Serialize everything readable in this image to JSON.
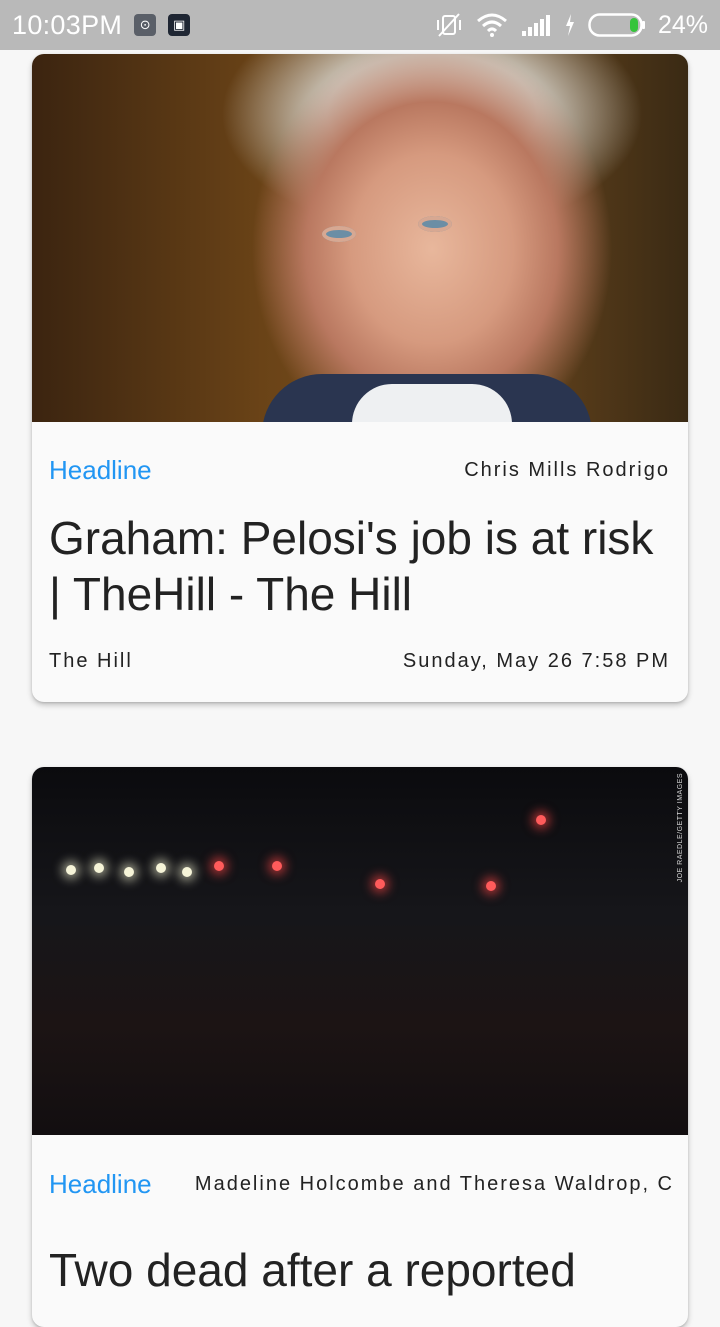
{
  "status_bar": {
    "time": "10:03PM",
    "battery_percent": "24%",
    "battery_level": 0.24,
    "icons": [
      "app-icon-1",
      "app-icon-2",
      "vibrate-off-icon",
      "wifi-icon",
      "signal-icon",
      "charging-icon",
      "battery-icon"
    ]
  },
  "articles": [
    {
      "tag": "Headline",
      "author": "Chris Mills Rodrigo",
      "title": "Graham: Pelosi's job is at risk | TheHill - The Hill",
      "source": "The Hill",
      "date": "Sunday, May 26 7:58 PM"
    },
    {
      "tag": "Headline",
      "author": "Madeline Holcombe and Theresa Waldrop, C",
      "title": "Two dead after a reported",
      "photo_credit": "JOE RAEDLE/GETTY IMAGES"
    }
  ],
  "colors": {
    "accent": "#2196f3",
    "status_bar": "#b9b9b9",
    "background": "#f7f7f7",
    "battery_fill": "#36c43b"
  }
}
